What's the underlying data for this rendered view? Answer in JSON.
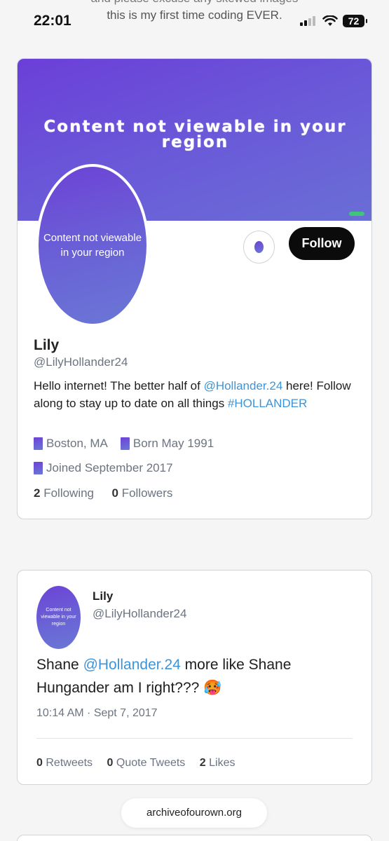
{
  "status_bar": {
    "time": "22:01",
    "battery": "72",
    "overlay_line_1": "and please excuse any skewed images",
    "overlay_line_2": "this is my first time coding EVER."
  },
  "profile": {
    "banner_text": "Content not viewable in your region",
    "avatar_text": "Content not viewable in your region",
    "follow_label": "Follow",
    "name": "Lily",
    "handle": "@LilyHollander24",
    "bio": {
      "part1": "Hello internet! The better half of ",
      "mention": "@Hollander.24",
      "part2": " here! Follow along to stay up to date on all things ",
      "hashtag": "#HOLLANDER"
    },
    "location": "Boston, MA",
    "born": "Born May 1991",
    "joined": "Joined September 2017",
    "following_count": "2",
    "following_label": "Following",
    "followers_count": "0",
    "followers_label": "Followers"
  },
  "tweet": {
    "avatar_text": "Content not viewable in your region",
    "name": "Lily",
    "handle": "@LilyHollander24",
    "body_part1": "Shane ",
    "mention": "@Hollander.24",
    "body_part2": " more like Shane Hungander am I right??? ",
    "emoji": "🥵",
    "timestamp": "10:14 AM · Sept 7, 2017",
    "retweets_count": "0",
    "retweets_label": "Retweets",
    "quotes_count": "0",
    "quotes_label": "Quote Tweets",
    "likes_count": "2",
    "likes_label": "Likes"
  },
  "browser": {
    "url": "archiveofourown.org"
  },
  "colors": {
    "accent_link": "#3d94d8",
    "banner_purple": "#6b3fd8",
    "follow_button": "#0b0b0b"
  }
}
